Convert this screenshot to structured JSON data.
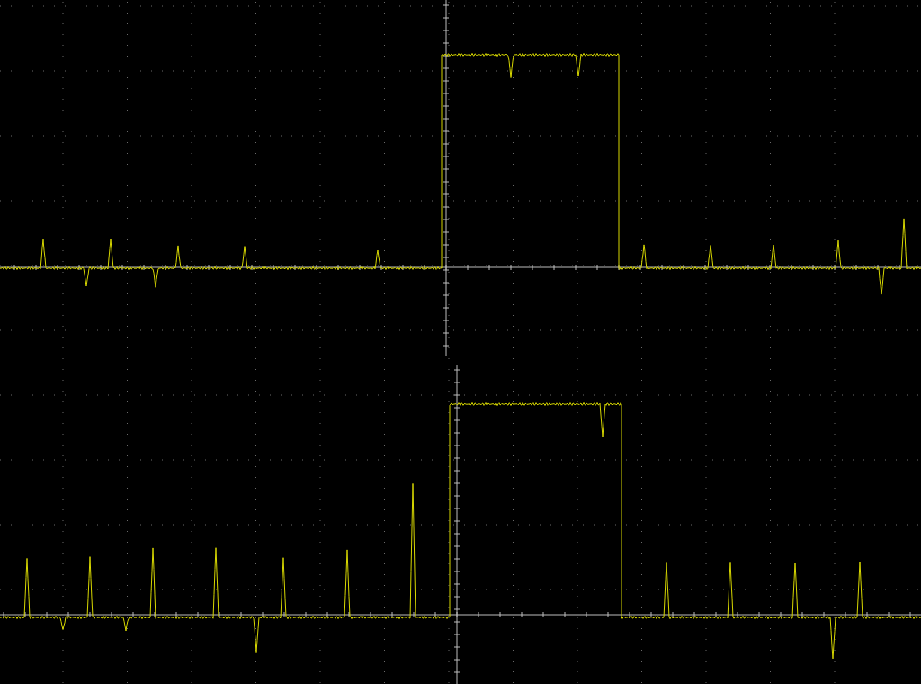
{
  "traces": [
    {
      "kind": "pulse"
    },
    {
      "kind": "pulse"
    }
  ]
}
